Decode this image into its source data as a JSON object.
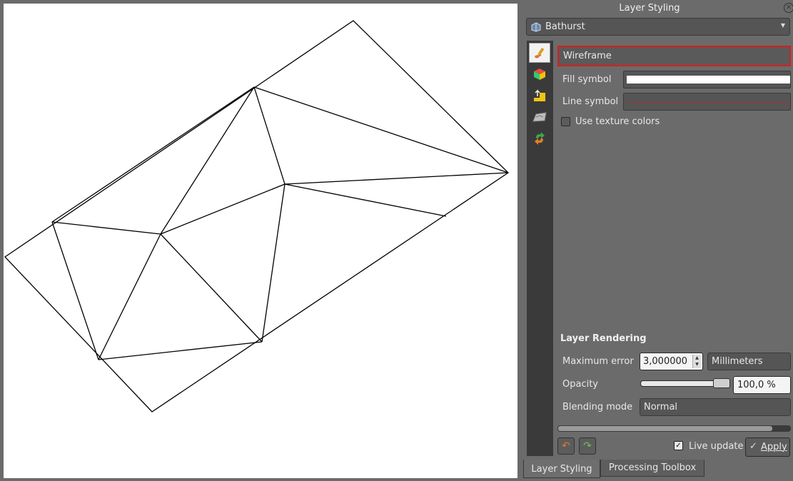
{
  "panel": {
    "title": "Layer Styling",
    "close_icon": "close-icon",
    "layer_name": "Bathurst",
    "render_type": "Wireframe",
    "fill_symbol_label": "Fill symbol",
    "line_symbol_label": "Line symbol",
    "use_texture_label": "Use texture colors",
    "use_texture_checked": false,
    "rendering": {
      "section_title": "Layer Rendering",
      "max_error_label": "Maximum error",
      "max_error_value": "3,000000",
      "unit": "Millimeters",
      "opacity_label": "Opacity",
      "opacity_value": "100,0 %",
      "opacity_level": 1.0,
      "blending_label": "Blending mode",
      "blending_value": "Normal"
    },
    "live_update_label": "Live update",
    "live_update_checked": true,
    "apply_label": "Apply"
  },
  "tabs": [
    {
      "label": "Layer Styling",
      "active": true
    },
    {
      "label": "Processing Toolbox",
      "active": false
    }
  ],
  "sidebar_icons": [
    "paintbrush-icon",
    "cube-icon",
    "elevation-icon",
    "terrain-icon",
    "history-icon"
  ],
  "colors": {
    "highlight": "#e01b1b",
    "panel_bg": "#6b6b6b",
    "toolbar_bg": "#3a3a3a",
    "canvas_bg": "#ffffff",
    "mesh_line": "#000000"
  }
}
